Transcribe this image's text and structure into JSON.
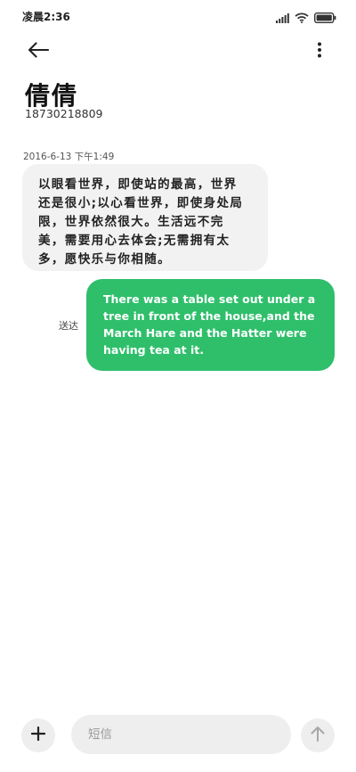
{
  "status_bar": {
    "time": "凌晨2:36",
    "icons": [
      "signal-icon",
      "wifi-icon",
      "battery-icon"
    ]
  },
  "header": {
    "back_icon": "arrow-left-icon",
    "more_icon": "more-vertical-icon",
    "contact_name": "倩倩",
    "contact_number": "18730218809"
  },
  "conversation": {
    "timestamp": "2016-6-13 下午1:49",
    "incoming_message": "以眼看世界，即使站的最高，世界还是很小;以心看世界，即使身处局限，世界依然很大。生活远不完美，需要用心去体会;无需拥有太多，愿快乐与你相随。",
    "outgoing_status": "送达",
    "outgoing_message": "There was a table set out under a tree in front of the house,and the March Hare and the Hatter were having tea at it."
  },
  "composer": {
    "add_icon": "plus-icon",
    "placeholder": "短信",
    "send_icon": "arrow-up-icon"
  },
  "colors": {
    "outgoing_bubble": "#2fbf6b",
    "incoming_bubble": "#f2f2f2",
    "background": "#ffffff"
  }
}
